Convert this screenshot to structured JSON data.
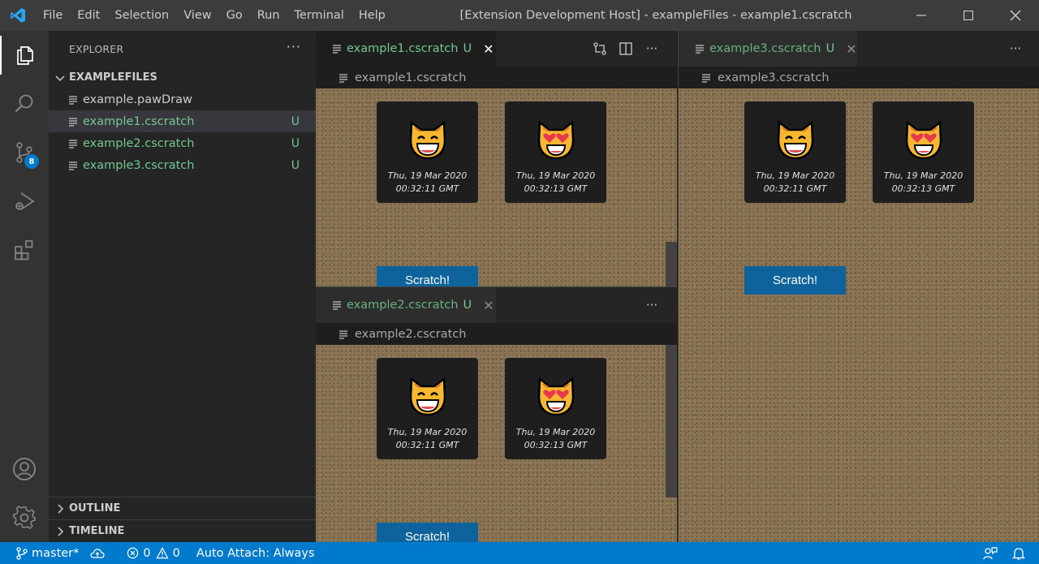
{
  "titlebar": {
    "menu": [
      "File",
      "Edit",
      "Selection",
      "View",
      "Go",
      "Run",
      "Terminal",
      "Help"
    ],
    "title": "[Extension Development Host] - exampleFiles - example1.cscratch"
  },
  "activity_bar": {
    "items": [
      "explorer-icon",
      "search-icon",
      "source-control-icon",
      "run-debug-icon",
      "extensions-icon"
    ],
    "source_control_badge": "8",
    "bottom": [
      "accounts-icon",
      "manage-gear-icon"
    ]
  },
  "sidebar": {
    "header": "EXPLORER",
    "folder": "EXAMPLEFILES",
    "files": [
      {
        "name": "example.pawDraw",
        "status": ""
      },
      {
        "name": "example1.cscratch",
        "status": "U"
      },
      {
        "name": "example2.cscratch",
        "status": "U"
      },
      {
        "name": "example3.cscratch",
        "status": "U"
      }
    ],
    "outline": "OUTLINE",
    "timeline": "TIMELINE"
  },
  "editors": {
    "group1": {
      "tab": "example1.cscratch",
      "status": "U",
      "breadcrumb": "example1.cscratch"
    },
    "group2": {
      "tab": "example2.cscratch",
      "status": "U",
      "breadcrumb": "example2.cscratch"
    },
    "group3": {
      "tab": "example3.cscratch",
      "status": "U",
      "breadcrumb": "example3.cscratch"
    }
  },
  "cards": {
    "card1": {
      "date_line1": "Thu, 19 Mar 2020",
      "date_line2": "00:32:11 GMT",
      "emoji": "grinning-cat-icon"
    },
    "card2": {
      "date_line1": "Thu, 19 Mar 2020",
      "date_line2": "00:32:13 GMT",
      "emoji": "heart-eyes-cat-icon"
    }
  },
  "scratch_button": "Scratch!",
  "statusbar": {
    "branch": "master*",
    "errors": "0",
    "warnings": "0",
    "auto_attach": "Auto Attach: Always"
  },
  "colors": {
    "accent": "#007acc",
    "untracked": "#73c991",
    "button": "#0e639c"
  }
}
